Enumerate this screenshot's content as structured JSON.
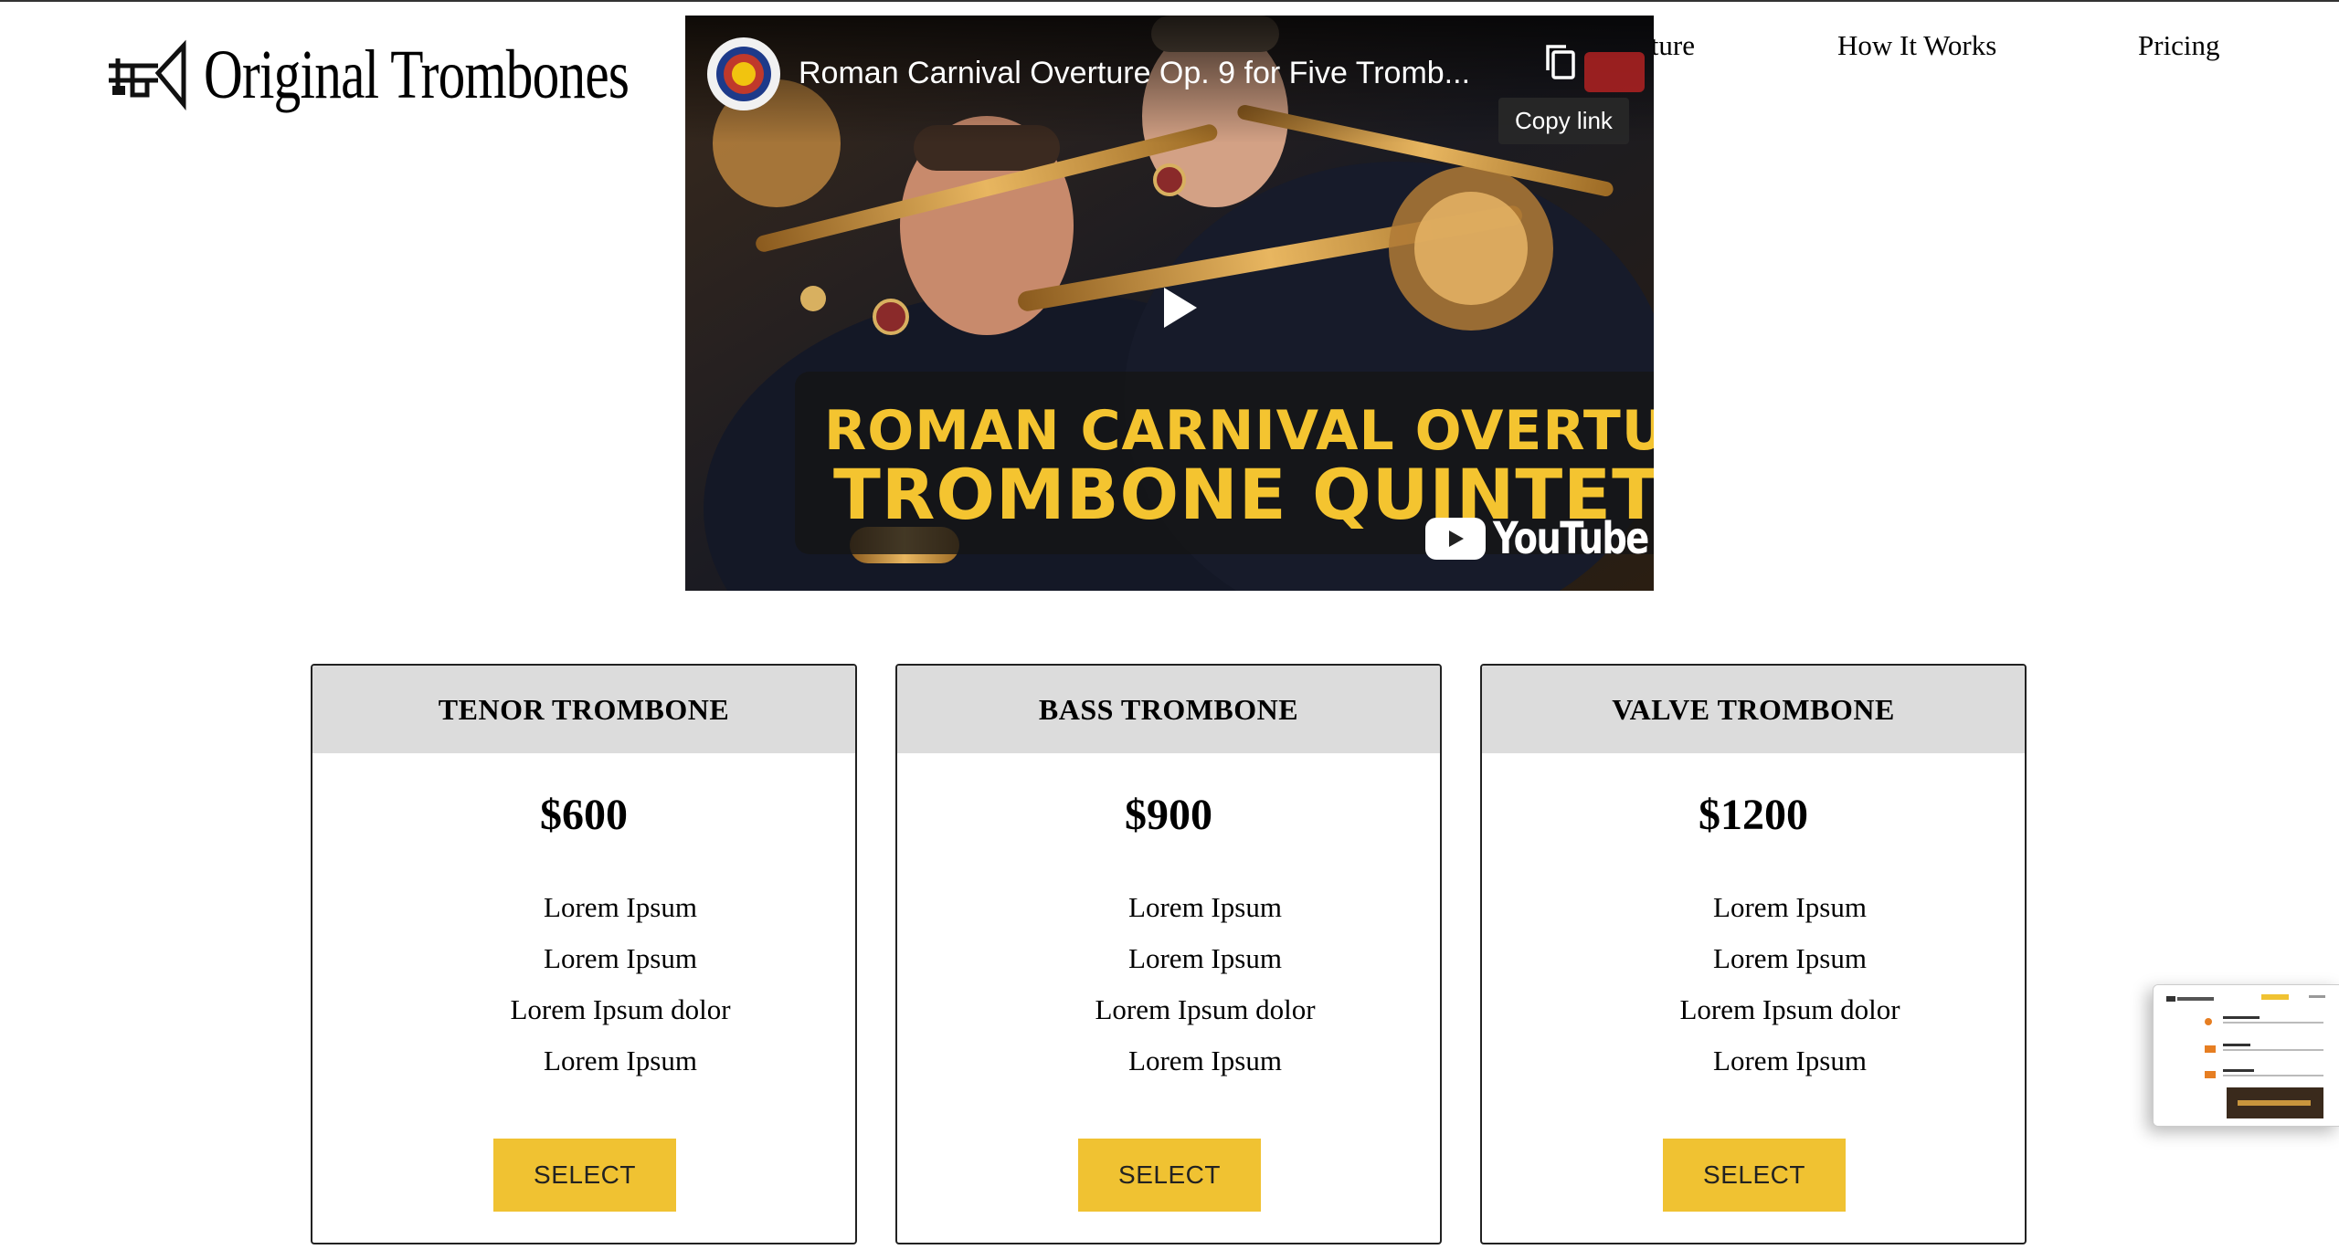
{
  "brand": {
    "name": "Original Trombones"
  },
  "nav": {
    "feature": "Feature",
    "how_it_works": "How It Works",
    "pricing": "Pricing"
  },
  "video": {
    "title": "Roman Carnival Overture Op. 9 for Five Tromb...",
    "copy_link": "Copy link",
    "banner_line1": "ROMAN CARNIVAL OVERTURE",
    "banner_line2": "TROMBONE QUINTET",
    "youtube": "YouTube"
  },
  "cards": [
    {
      "name": "TENOR TROMBONE",
      "price": "$600",
      "features": [
        "Lorem Ipsum",
        "Lorem Ipsum",
        "Lorem Ipsum dolor",
        "Lorem Ipsum"
      ],
      "button": "SELECT"
    },
    {
      "name": "BASS TROMBONE",
      "price": "$900",
      "features": [
        "Lorem Ipsum",
        "Lorem Ipsum",
        "Lorem Ipsum dolor",
        "Lorem Ipsum"
      ],
      "button": "SELECT"
    },
    {
      "name": "VALVE TROMBONE",
      "price": "$1200",
      "features": [
        "Lorem Ipsum",
        "Lorem Ipsum",
        "Lorem Ipsum dolor",
        "Lorem Ipsum"
      ],
      "button": "SELECT"
    }
  ],
  "colors": {
    "accent": "#f0c232",
    "card_header": "#dcdcdc",
    "banner_text": "#f4c430"
  },
  "icons": [
    "trombone-logo-icon",
    "channel-avatar-icon",
    "copy-icon",
    "play-icon",
    "youtube-logo-icon"
  ]
}
